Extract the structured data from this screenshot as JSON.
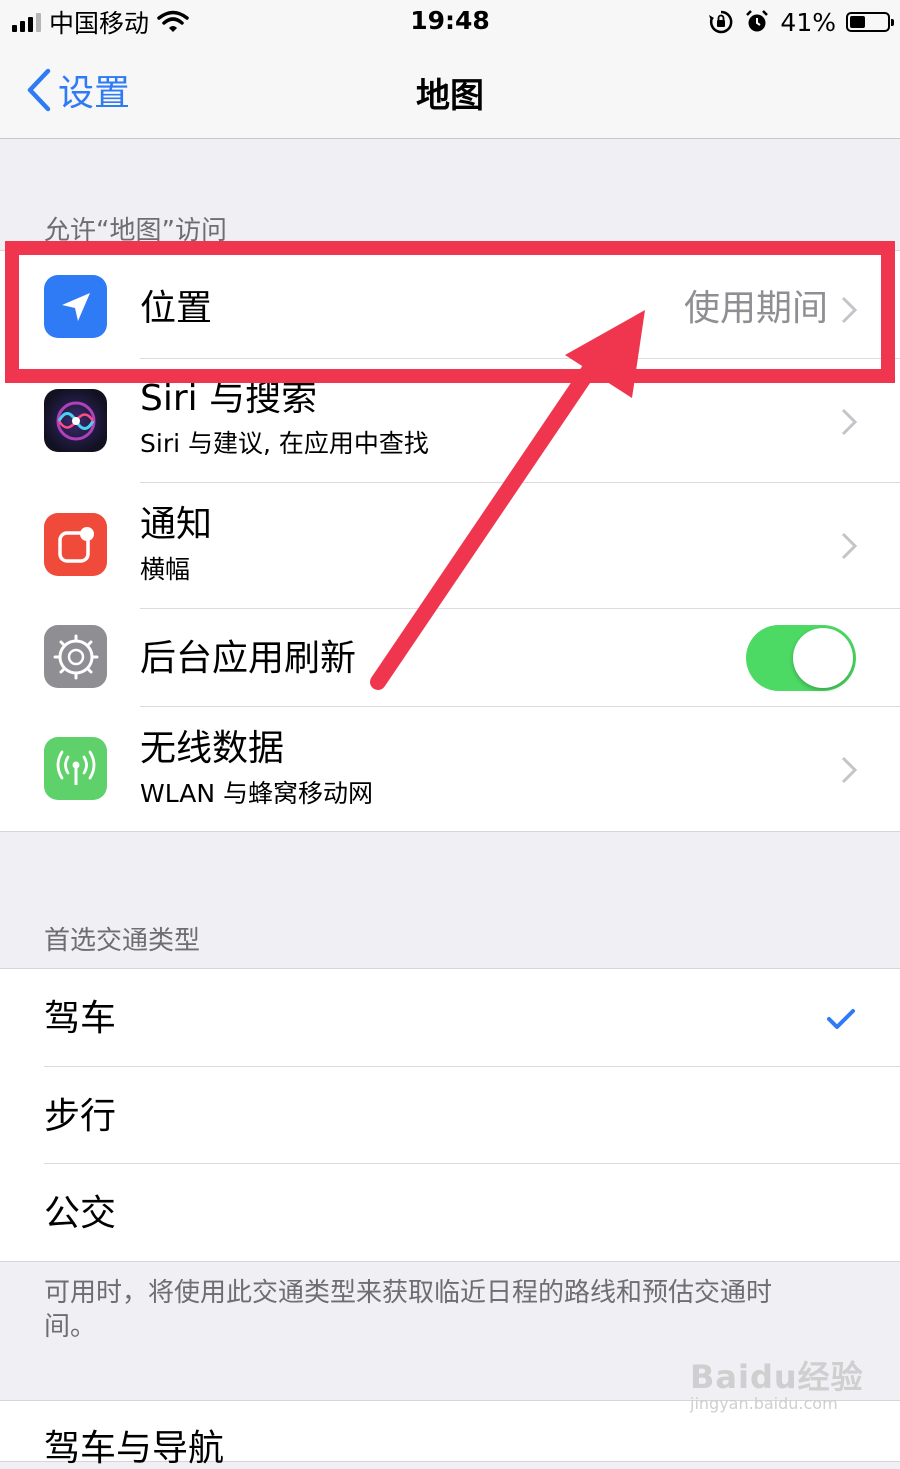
{
  "status_bar": {
    "carrier": "中国移动",
    "time": "19:48",
    "battery": "41%",
    "battery_level": 0.41
  },
  "nav": {
    "back_label": "设置",
    "title": "地图"
  },
  "access_section": {
    "header": "允许“地图”访问",
    "rows": [
      {
        "title": "位置",
        "value": "使用期间",
        "icon": "location-arrow-icon",
        "icon_color": "#2f7bf5"
      },
      {
        "title": "Siri 与搜索",
        "subtitle": "Siri 与建议, 在应用中查找",
        "icon": "siri-icon"
      },
      {
        "title": "通知",
        "subtitle": "横幅",
        "icon": "notification-icon",
        "icon_color": "#f04a3a"
      },
      {
        "title": "后台应用刷新",
        "toggle_on": true,
        "icon": "gear-icon",
        "icon_color": "#8e8e93"
      },
      {
        "title": "无线数据",
        "subtitle": "WLAN 与蜂窝移动网",
        "icon": "antenna-icon",
        "icon_color": "#5ed16a"
      }
    ]
  },
  "transport_section": {
    "header": "首选交通类型",
    "rows": [
      {
        "title": "驾车",
        "selected": true
      },
      {
        "title": "步行",
        "selected": false
      },
      {
        "title": "公交",
        "selected": false
      }
    ],
    "footer": "可用时，将使用此交通类型来获取临近日程的路线和预估交通时间。"
  },
  "next_section": {
    "row_title": "驾车与导航"
  },
  "annotation": {
    "color": "#f0364f"
  },
  "watermark": {
    "brand": "Baidu经验",
    "url": "jingyan.baidu.com"
  }
}
